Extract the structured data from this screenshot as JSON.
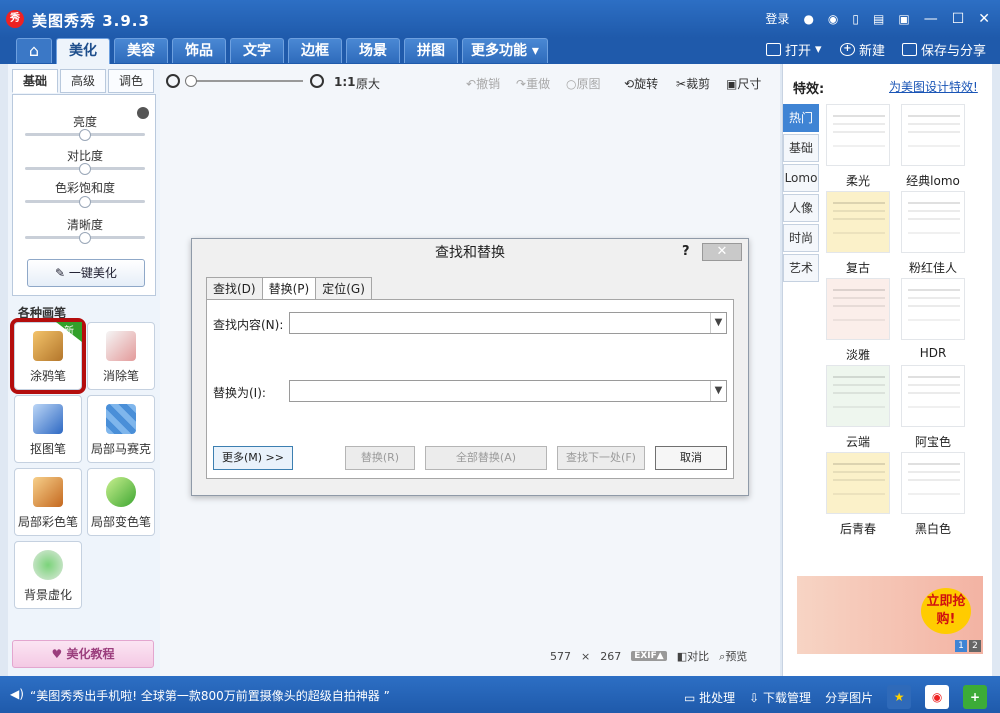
{
  "app": {
    "logo_text": "秀",
    "title": "美图秀秀 3.9.3",
    "login": "登录"
  },
  "tabs": [
    "美化",
    "美容",
    "饰品",
    "文字",
    "边框",
    "场景",
    "拼图",
    "更多功能 ▾"
  ],
  "tab_actions": {
    "open": "打开",
    "new": "新建",
    "save_share": "保存与分享"
  },
  "left_panel": {
    "subtabs": [
      "基础",
      "高级",
      "调色"
    ],
    "sliders": [
      {
        "label": "亮度",
        "value": 0.5
      },
      {
        "label": "对比度",
        "value": 0.5
      },
      {
        "label": "色彩饱和度",
        "value": 0.5
      },
      {
        "label": "清晰度",
        "value": 0.5
      }
    ],
    "onekey": "一键美化",
    "brushes_title": "各种画笔",
    "brushes": [
      "涂鸦笔",
      "消除笔",
      "抠图笔",
      "局部马赛克",
      "局部彩色笔",
      "局部变色笔",
      "背景虚化"
    ],
    "badge_new": "新",
    "tutorial": "美化教程"
  },
  "toolbar": {
    "zoom_ratio": "1:1",
    "original_size": "原大",
    "undo": "撤销",
    "redo": "重做",
    "original": "原图",
    "rotate": "旋转",
    "crop": "裁剪",
    "size": "尺寸"
  },
  "dialog": {
    "title": "查找和替换",
    "help": "?",
    "close": "✕",
    "tabs": [
      "查找(D)",
      "替换(P)",
      "定位(G)"
    ],
    "find_label": "查找内容(N):",
    "replace_label": "替换为(I):",
    "find_value": "",
    "replace_value": "",
    "more_button": "更多(M) >>",
    "replace_button": "替换(R)",
    "replace_all_button": "全部替换(A)",
    "find_next_button": "查找下一处(F)",
    "cancel_button": "取消"
  },
  "canvas_info": {
    "width": "577",
    "times": "×",
    "height": "267",
    "exif": "EXIF▲",
    "compare": "对比",
    "preview": "预览"
  },
  "right_panel": {
    "title": "特效:",
    "link": "为美图设计特效!",
    "categories": [
      "热门",
      "基础",
      "Lomo",
      "人像",
      "时尚",
      "艺术"
    ],
    "effects": [
      "柔光",
      "经典lomo",
      "复古",
      "粉红佳人",
      "淡雅",
      "HDR",
      "云端",
      "阿宝色",
      "后青春",
      "黑白色"
    ],
    "ad_text": "立即抢购!",
    "ad_pages": [
      "1",
      "2"
    ]
  },
  "statusbar": {
    "message": "“美图秀秀出手机啦! 全球第一款800万前置摄像头的超级自拍神器 ”",
    "batch": "批处理",
    "download": "下载管理",
    "share": "分享图片"
  },
  "colors": {
    "titlebar": "#1f5aab",
    "accent": "#3f84d4",
    "highlight_border": "#b40d0d",
    "badge_green": "#32a02a"
  }
}
